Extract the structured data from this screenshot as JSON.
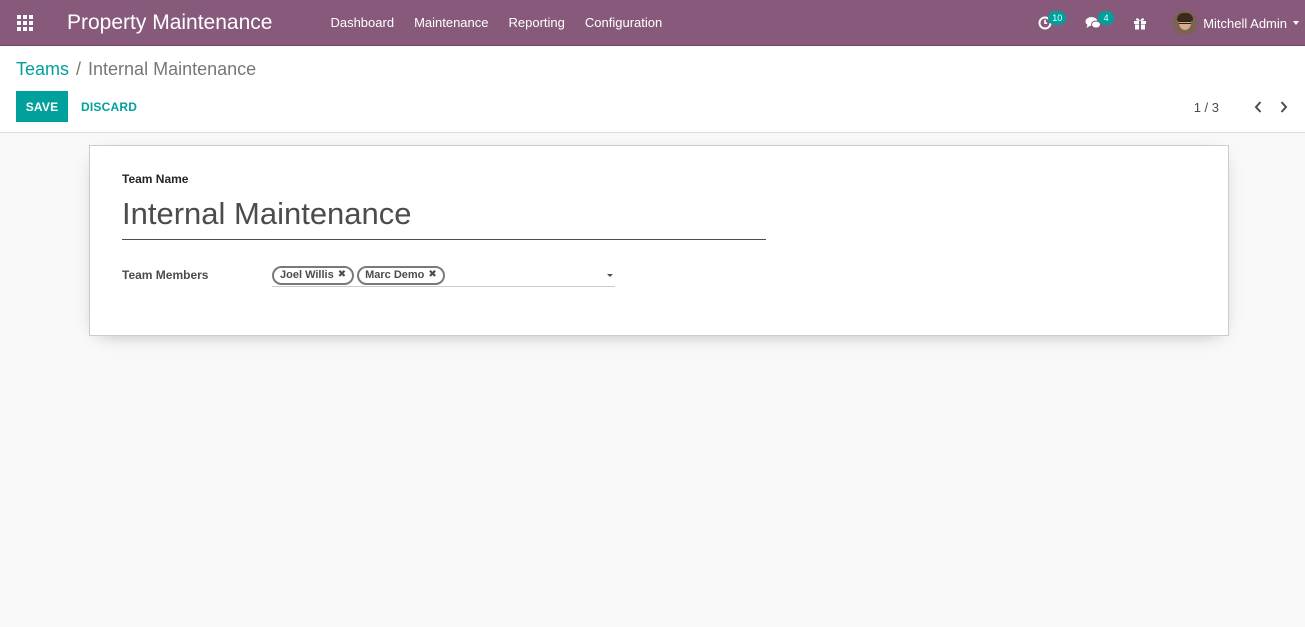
{
  "navbar": {
    "apps_icon": "apps-grid-icon",
    "brand": "Property Maintenance",
    "menu": [
      {
        "label": "Dashboard"
      },
      {
        "label": "Maintenance"
      },
      {
        "label": "Reporting"
      },
      {
        "label": "Configuration"
      }
    ],
    "systray": {
      "activities_icon": "clock-icon",
      "activities_count": "10",
      "messages_icon": "comments-icon",
      "messages_count": "4",
      "gift_icon": "gift-icon",
      "user_name": "Mitchell Admin"
    }
  },
  "control_panel": {
    "breadcrumb_parent": "Teams",
    "breadcrumb_separator": "/",
    "breadcrumb_current": "Internal Maintenance",
    "save_label": "SAVE",
    "discard_label": "DISCARD",
    "pager": "1 / 3"
  },
  "form": {
    "team_name_label": "Team Name",
    "team_name_value": "Internal Maintenance",
    "team_members_label": "Team Members",
    "team_members": [
      {
        "name": "Joel Willis"
      },
      {
        "name": "Marc Demo"
      }
    ]
  },
  "colors": {
    "navbar": "#875a7b",
    "accent": "#00a09d",
    "background": "#f9f9f9"
  }
}
